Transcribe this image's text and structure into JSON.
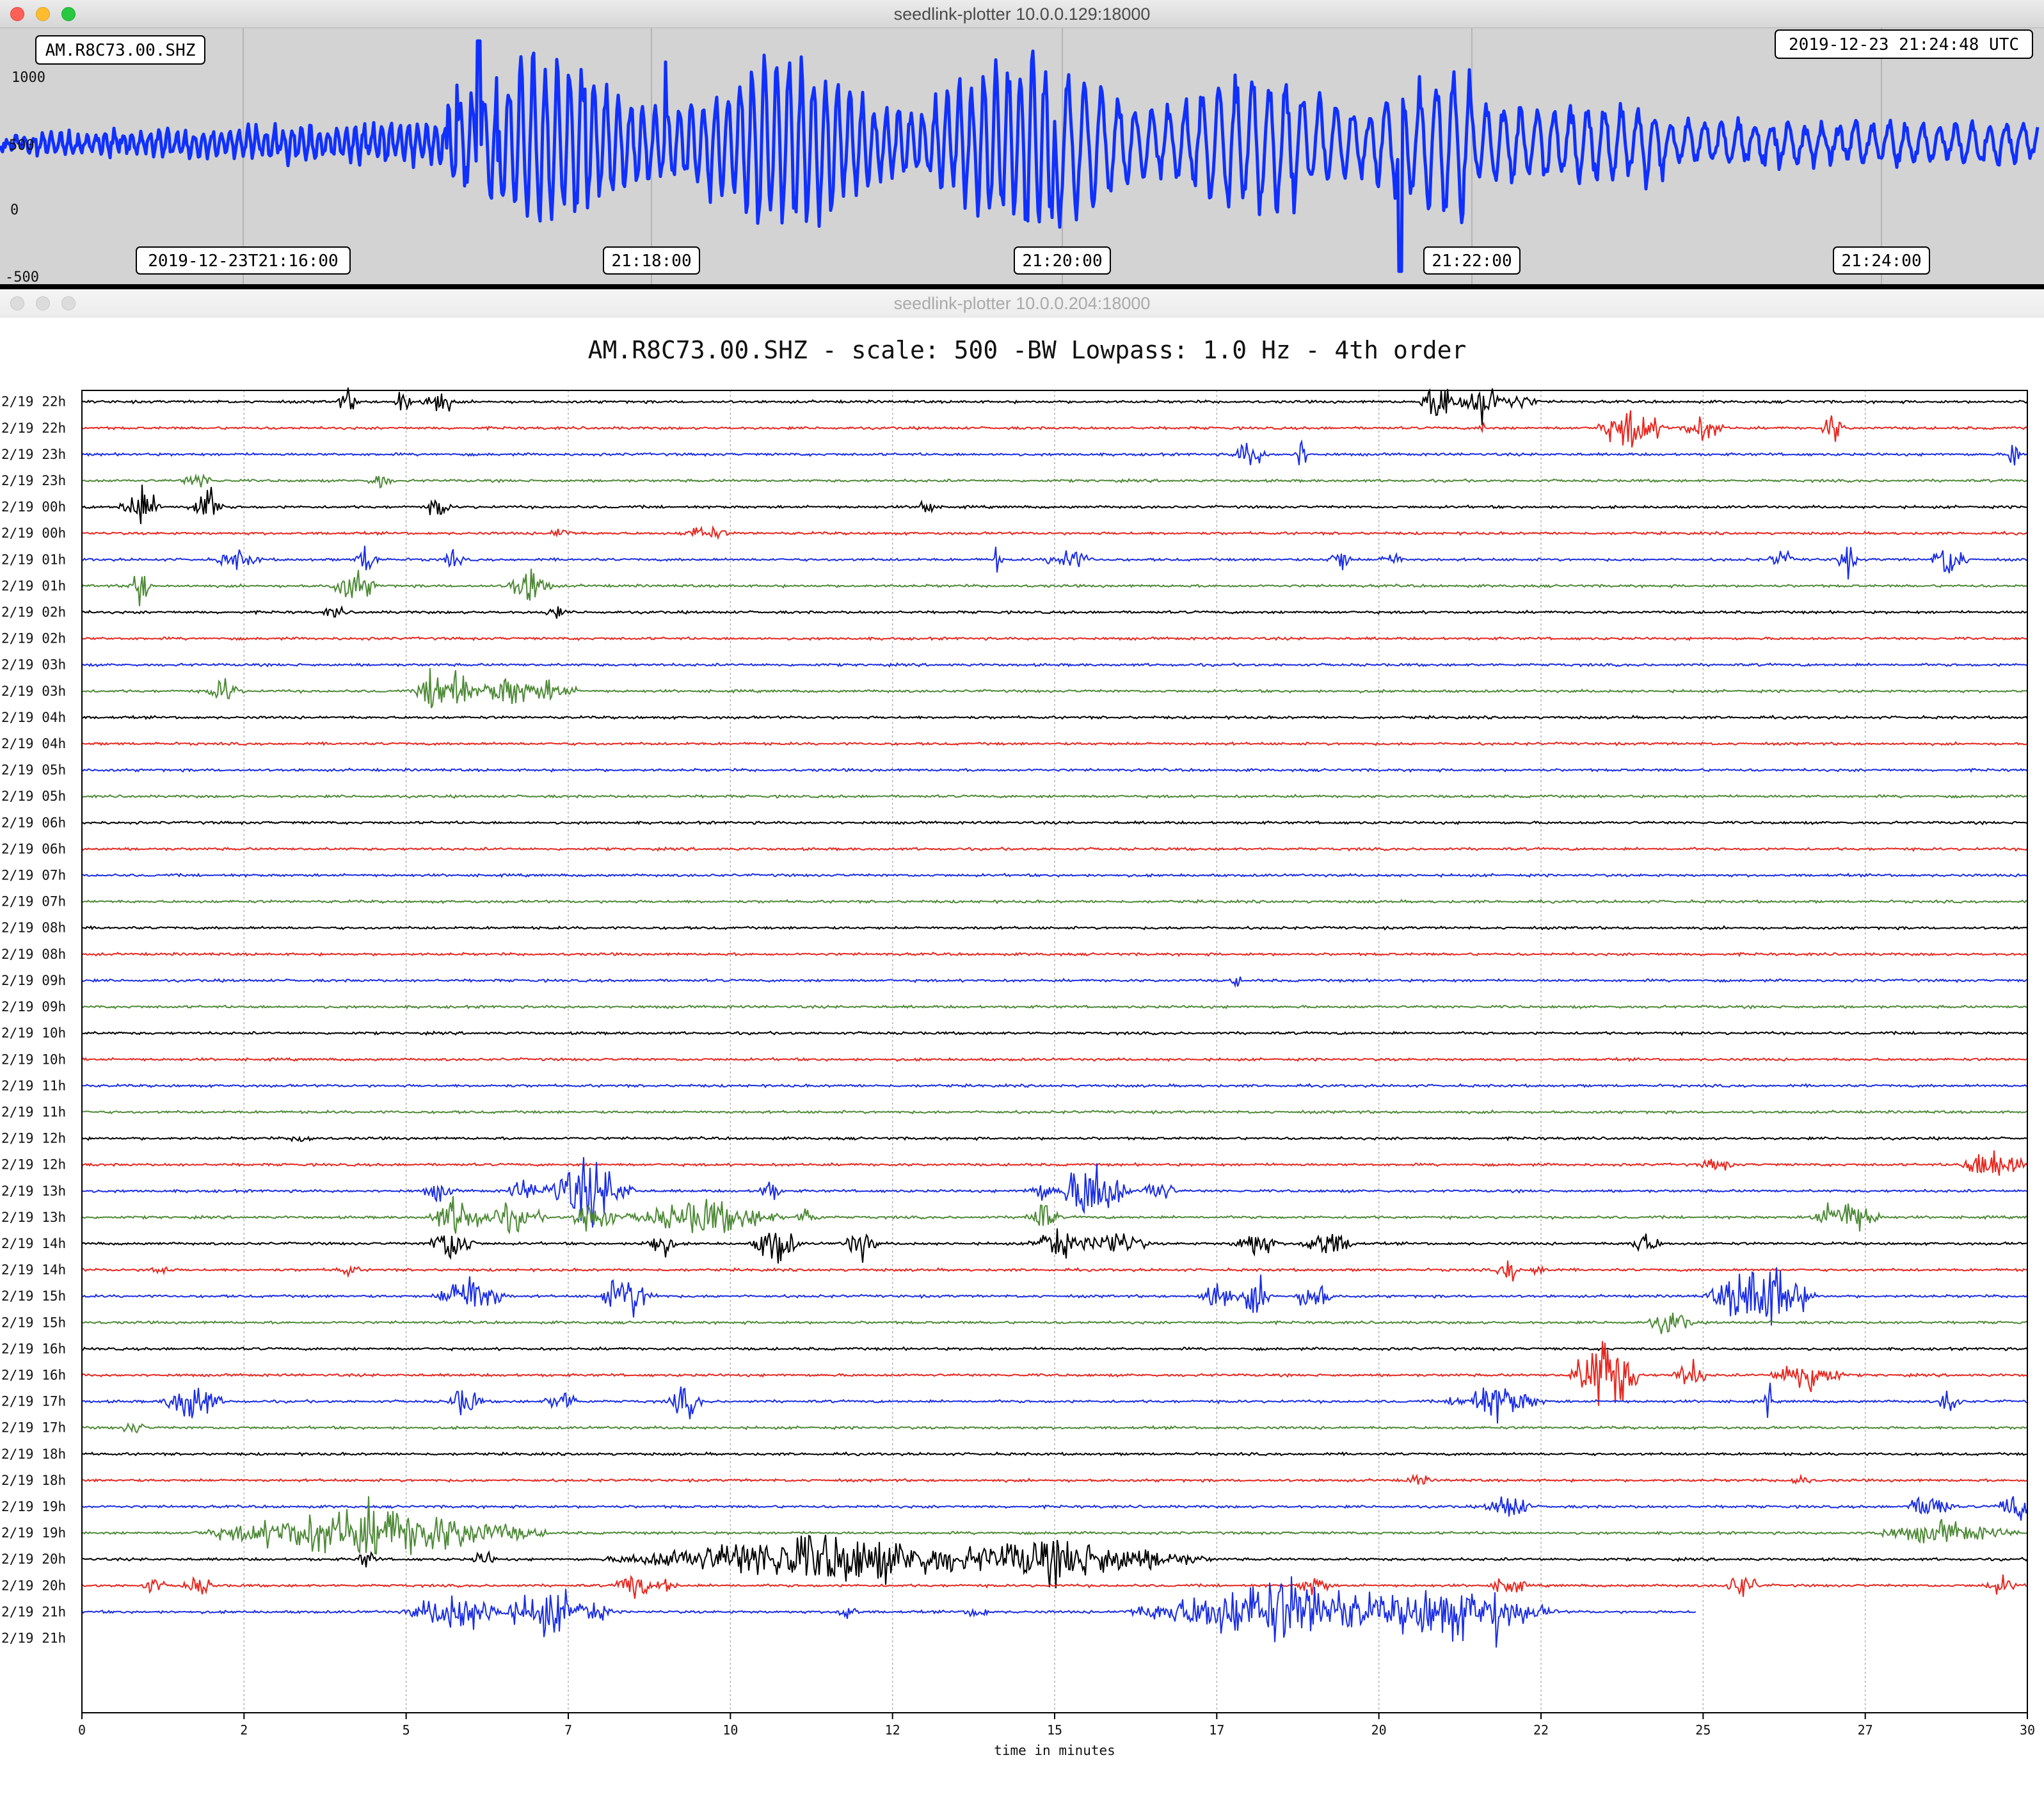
{
  "windows": [
    {
      "title": "seedlink-plotter 10.0.0.129:18000",
      "station_label": "AM.R8C73.00.SHZ",
      "timestamp": "2019-12-23 21:24:48 UTC",
      "y_ticks": [
        "1000",
        "500",
        "0",
        "-500"
      ],
      "x_ticks": [
        "2019-12-23T21:16:00",
        "21:18:00",
        "21:20:00",
        "21:22:00",
        "21:24:00"
      ],
      "trace_color": "#1030ff"
    },
    {
      "title": "seedlink-plotter 10.0.0.204:18000",
      "plot_title": "AM.R8C73.00.SHZ - scale: 500 -BW Lowpass: 1.0 Hz - 4th order",
      "xlabel": "time in minutes",
      "x_ticks": [
        "0",
        "2",
        "5",
        "7",
        "10",
        "12",
        "15",
        "17",
        "20",
        "22",
        "25",
        "27",
        "30"
      ],
      "row_labels": [
        "2/19 22h",
        "2/19 22h",
        "2/19 23h",
        "2/19 23h",
        "2/19 00h",
        "2/19 00h",
        "2/19 01h",
        "2/19 01h",
        "2/19 02h",
        "2/19 02h",
        "2/19 03h",
        "2/19 03h",
        "2/19 04h",
        "2/19 04h",
        "2/19 05h",
        "2/19 05h",
        "2/19 06h",
        "2/19 06h",
        "2/19 07h",
        "2/19 07h",
        "2/19 08h",
        "2/19 08h",
        "2/19 09h",
        "2/19 09h",
        "2/19 10h",
        "2/19 10h",
        "2/19 11h",
        "2/19 11h",
        "2/19 12h",
        "2/19 12h",
        "2/19 13h",
        "2/19 13h",
        "2/19 14h",
        "2/19 14h",
        "2/19 15h",
        "2/19 15h",
        "2/19 16h",
        "2/19 16h",
        "2/19 17h",
        "2/19 17h",
        "2/19 18h",
        "2/19 18h",
        "2/19 19h",
        "2/19 19h",
        "2/19 20h",
        "2/19 20h",
        "2/19 21h",
        "2/19 21h"
      ],
      "trace_colors": [
        "#000000",
        "#e8261e",
        "#1a2de6",
        "#4e8a37"
      ]
    }
  ]
}
